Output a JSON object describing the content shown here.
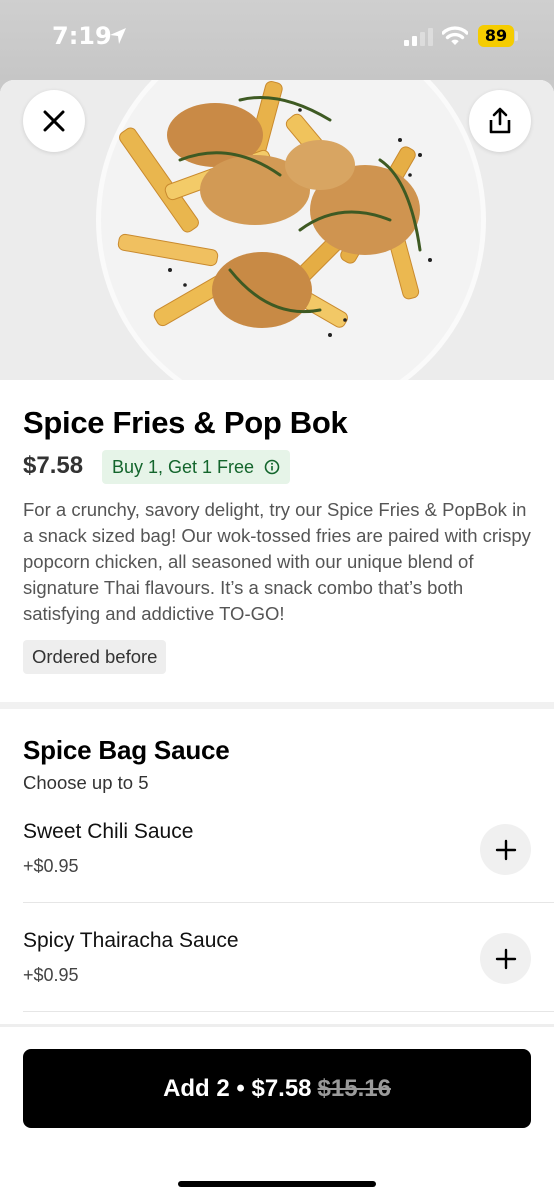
{
  "status_bar": {
    "time": "7:19",
    "battery": "89",
    "battery_color": "#f5cc00",
    "icons": [
      "location-icon",
      "signal-icon",
      "wifi-icon"
    ]
  },
  "header": {
    "close_icon": "close-icon",
    "share_icon": "share-icon"
  },
  "item": {
    "title": "Spice Fries & Pop Bok",
    "price": "$7.58",
    "promo": "Buy 1, Get 1 Free",
    "promo_color": "#13652c",
    "description": "For a crunchy, savory delight, try our Spice Fries & PopBok in a snack sized bag! Our wok-tossed fries are paired with crispy popcorn chicken, all seasoned with our unique  blend of signature Thai flavours. It’s a snack combo that’s both satisfying and addictive TO-GO!",
    "ordered_before": "Ordered before"
  },
  "section": {
    "title": "Spice Bag Sauce",
    "subtitle": "Choose up to 5",
    "options": [
      {
        "name": "Sweet Chili Sauce",
        "price": "+$0.95"
      },
      {
        "name": "Spicy Thairacha Sauce",
        "price": "+$0.95"
      }
    ]
  },
  "cta": {
    "label": "Add 2 • $7.58",
    "original_price": "$15.16"
  }
}
